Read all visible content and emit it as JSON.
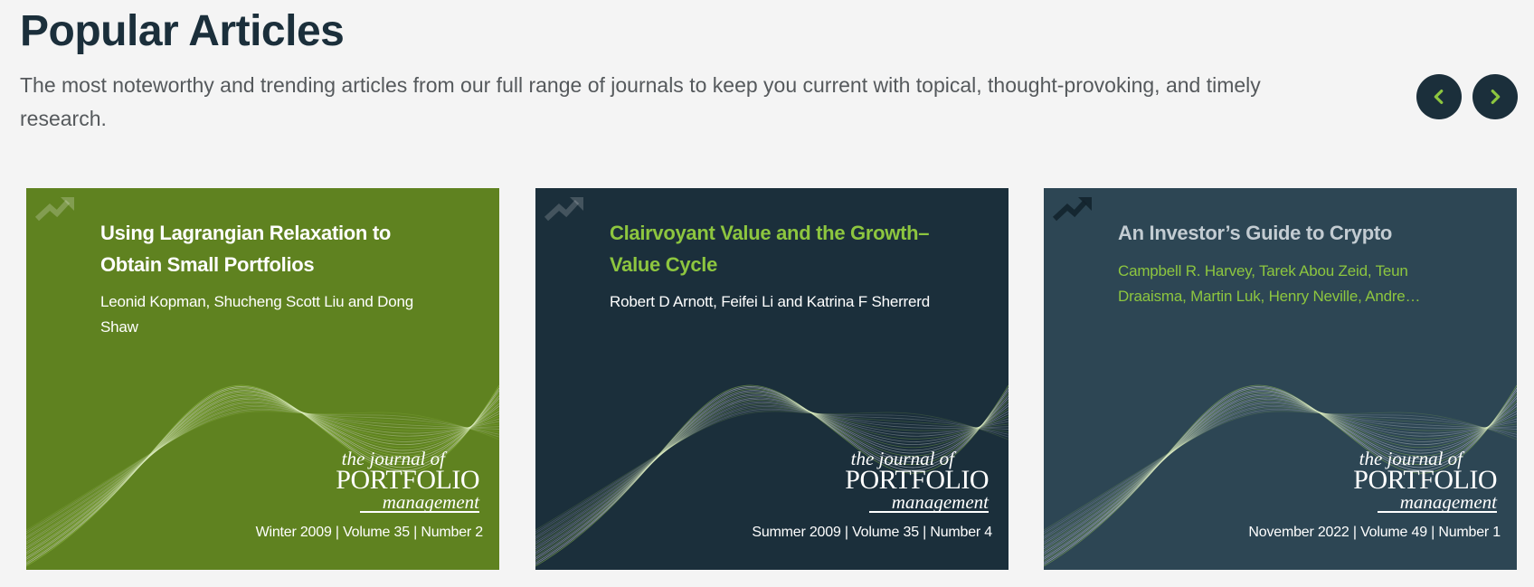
{
  "section": {
    "title": "Popular Articles",
    "description": "The most noteworthy and trending articles from our full range of journals to keep you current with topical, thought-provoking, and timely research."
  },
  "nav": {
    "prev_icon": "chevron-left-icon",
    "next_icon": "chevron-right-icon",
    "button_color": "#1b2f3b",
    "chevron_color": "#8dc63f"
  },
  "journal_logo": {
    "line1": "the journal of",
    "line2": "PORTFOLIO",
    "line3": "management"
  },
  "articles": [
    {
      "title": "Using Lagrangian Relaxation to Obtain Small Portfolios",
      "authors": "Leonid Kopman, Shucheng Scott Liu and Dong Shaw",
      "issue": "Winter 2009 | Volume 35 | Number 2",
      "background": "#5f8220",
      "title_color": "#ffffff",
      "authors_color": "#ffffff",
      "icon": "trending-up-icon"
    },
    {
      "title": "Clairvoyant Value and the Growth–Value Cycle",
      "authors": "Robert D Arnott, Feifei Li and Katrina F Sherrerd",
      "issue": "Summer 2009 | Volume 35 | Number 4",
      "background": "#1b2f3b",
      "title_color": "#8dc63f",
      "authors_color": "#ffffff",
      "icon": "trending-up-icon"
    },
    {
      "title": "An Investor’s Guide to Crypto",
      "authors": "Campbell R. Harvey, Tarek Abou Zeid, Teun Draaisma, Martin Luk, Henry Neville, Andre…",
      "issue": "November 2022 | Volume 49 | Number 1",
      "background": "#2d4654",
      "title_color": "#c3ccd2",
      "authors_color": "#8dc63f",
      "icon": "trending-up-icon"
    }
  ]
}
